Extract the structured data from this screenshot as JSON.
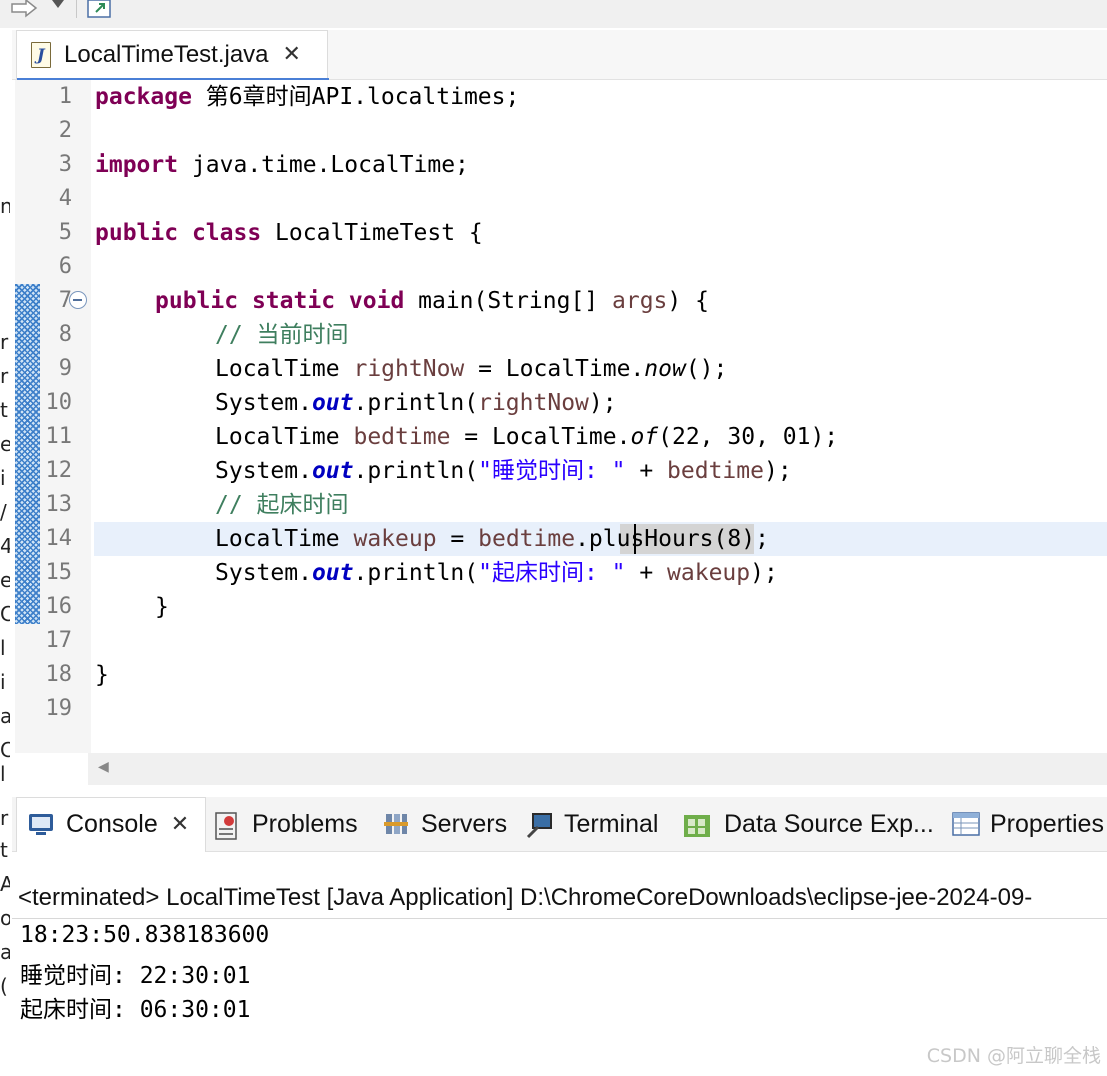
{
  "editor": {
    "tab_label": "LocalTimeTest.java",
    "line_numbers": [
      "1",
      "2",
      "3",
      "4",
      "5",
      "6",
      "7",
      "8",
      "9",
      "10",
      "11",
      "12",
      "13",
      "14",
      "15",
      "16",
      "17",
      "18",
      "19"
    ],
    "code": {
      "l1": {
        "kw": "package",
        "rest": " 第6章时间API.localtimes;"
      },
      "l3": {
        "kw": "import",
        "rest": " java.time.LocalTime;"
      },
      "l5": {
        "kw1": "public",
        "kw2": "class",
        "rest": " LocalTimeTest {"
      },
      "l7": {
        "kw1": "public",
        "kw2": "static",
        "kw3": "void",
        "mid": " main(String[] ",
        "var": "args",
        "end": ") {"
      },
      "l8": {
        "comment": "// 当前时间"
      },
      "l9": {
        "a": "LocalTime ",
        "var": "rightNow",
        "b": " = LocalTime.",
        "method": "now",
        "c": "();"
      },
      "l10": {
        "a": "System.",
        "field": "out",
        "b": ".println(",
        "var": "rightNow",
        "c": ");"
      },
      "l11": {
        "a": "LocalTime ",
        "var": "bedtime",
        "b": " = LocalTime.",
        "method": "of",
        "c": "(22, 30, 01);"
      },
      "l12": {
        "a": "System.",
        "field": "out",
        "b": ".println(",
        "str": "\"睡觉时间: \"",
        "c": " + ",
        "var": "bedtime",
        "d": ");"
      },
      "l13": {
        "comment": "// 起床时间"
      },
      "l14": {
        "a": "LocalTime ",
        "var": "wakeup",
        "b": " = ",
        "var2": "bedtime",
        "c": ".plusHours(8);"
      },
      "l15": {
        "a": "System.",
        "field": "out",
        "b": ".println(",
        "str": "\"起床时间: \"",
        "c": " + ",
        "var": "wakeup",
        "d": ");"
      },
      "l16": {
        "text": "}"
      },
      "l18": {
        "text": "}"
      }
    }
  },
  "panel": {
    "tabs": {
      "console": "Console",
      "problems": "Problems",
      "servers": "Servers",
      "terminal": "Terminal",
      "datasource": "Data Source Exp...",
      "properties": "Properties"
    },
    "console_description": "<terminated> LocalTimeTest [Java Application] D:\\ChromeCoreDownloads\\eclipse-jee-2024-09-",
    "output": [
      "18:23:50.838183600",
      "睡觉时间: 22:30:01",
      "起床时间: 06:30:01"
    ]
  },
  "left_strip_chars": [
    "n",
    "r",
    "r",
    "t",
    "e",
    "i",
    "/",
    "4",
    "e",
    "C",
    "l",
    "i",
    "a",
    "C",
    "l",
    "r",
    "t",
    "A",
    "o",
    "a",
    "("
  ],
  "watermark": "CSDN @阿立聊全栈",
  "colors": {
    "keyword": "#7f0055",
    "variable": "#6a3e3e",
    "comment": "#3f7f5f",
    "string": "#2a00ff",
    "field": "#0000c0",
    "tab_underline": "#4a7fd6"
  }
}
